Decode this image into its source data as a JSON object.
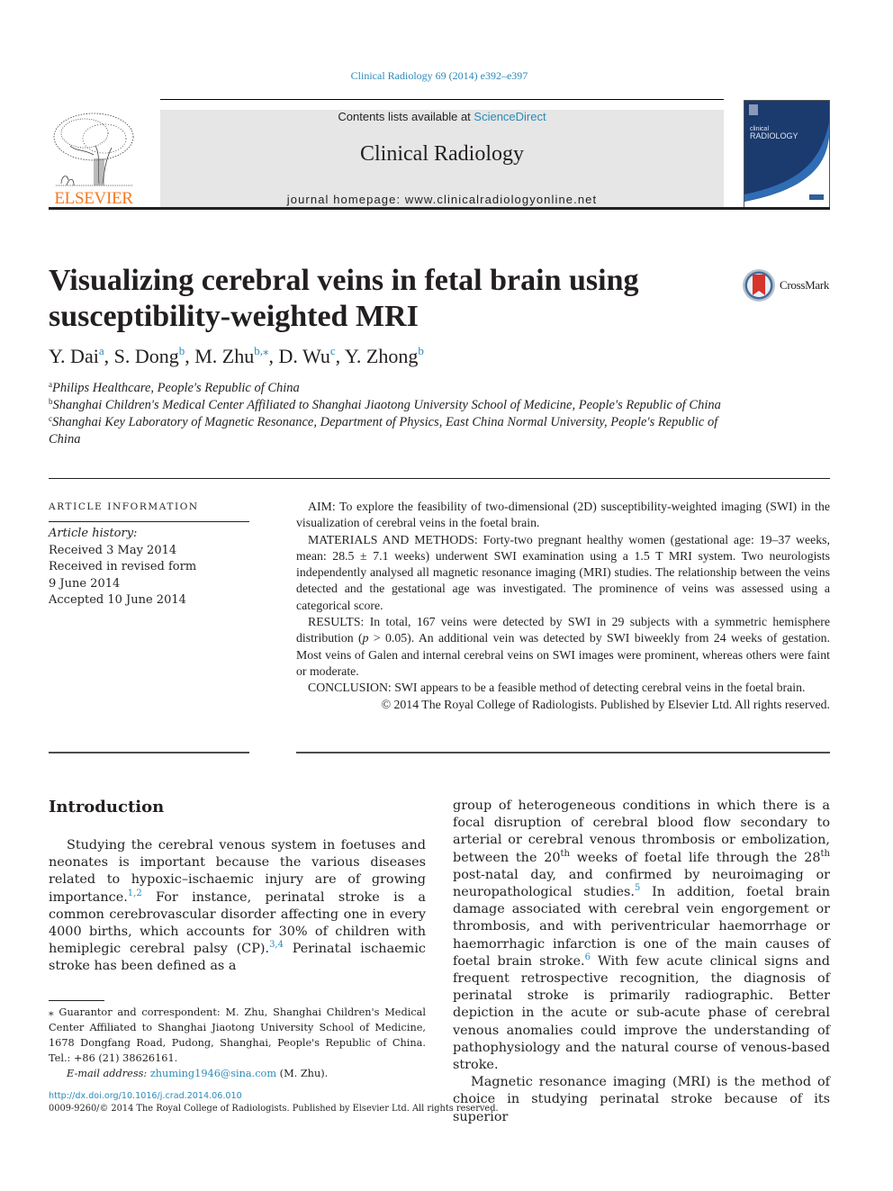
{
  "header": {
    "citation": "Clinical Radiology 69 (2014) e392–e397",
    "publisher_logo_text": "ELSEVIER",
    "contents_prefix": "Contents lists available at ",
    "contents_link": "ScienceDirect",
    "journal_name": "Clinical Radiology",
    "homepage_prefix": "journal homepage: ",
    "homepage_url": "www.clinicalradiologyonline.net",
    "cover_title_line1": "clinical",
    "cover_title_line2": "RADIOLOGY"
  },
  "article": {
    "title": "Visualizing cerebral veins in fetal brain using susceptibility-weighted MRI",
    "crossmark_label": "CrossMark",
    "authors": [
      {
        "name": "Y. Dai",
        "aff": "a"
      },
      {
        "name": "S. Dong",
        "aff": "b"
      },
      {
        "name": "M. Zhu",
        "aff": "b,⁎"
      },
      {
        "name": "D. Wu",
        "aff": "c"
      },
      {
        "name": "Y. Zhong",
        "aff": "b"
      }
    ],
    "affiliations": [
      {
        "key": "a",
        "text": "Philips Healthcare, People's Republic of China"
      },
      {
        "key": "b",
        "text": "Shanghai Children's Medical Center Affiliated to Shanghai Jiaotong University School of Medicine, People's Republic of China"
      },
      {
        "key": "c",
        "text": "Shanghai Key Laboratory of Magnetic Resonance, Department of Physics, East China Normal University, People's Republic of China"
      }
    ]
  },
  "article_info": {
    "heading": "ARTICLE INFORMATION",
    "history_label": "Article history:",
    "lines": [
      "Received 3 May 2014",
      "Received in revised form",
      "9 June 2014",
      "Accepted 10 June 2014"
    ]
  },
  "abstract": {
    "aim": "AIM: To explore the feasibility of two-dimensional (2D) susceptibility-weighted imaging (SWI) in the visualization of cerebral veins in the foetal brain.",
    "methods": "MATERIALS AND METHODS: Forty-two pregnant healthy women (gestational age: 19–37 weeks, mean: 28.5 ± 7.1 weeks) underwent SWI examination using a 1.5 T MRI system. Two neurologists independently analysed all magnetic resonance imaging (MRI) studies. The relationship between the veins detected and the gestational age was investigated. The prominence of veins was assessed using a categorical score.",
    "results_part1": "RESULTS: In total, 167 veins were detected by SWI in 29 subjects with a symmetric hemisphere distribution (",
    "results_p": "p",
    "results_part2": " > 0.05). An additional vein was detected by SWI biweekly from 24 weeks of gestation. Most veins of Galen and internal cerebral veins on SWI images were prominent, whereas others were faint or moderate.",
    "conclusion": "CONCLUSION: SWI appears to be a feasible method of detecting cerebral veins in the foetal brain.",
    "copyright": "© 2014 The Royal College of Radiologists. Published by Elsevier Ltd. All rights reserved."
  },
  "body": {
    "intro_heading": "Introduction",
    "left_p1_a": "Studying the cerebral venous system in foetuses and neonates is important because the various diseases related to hypoxic–ischaemic injury are of growing importance.",
    "left_p1_ref1": "1,2",
    "left_p1_b": " For instance, perinatal stroke is a common cerebrovascular disorder affecting one in every 4000 births, which accounts for 30% of children with hemiplegic cerebral palsy (CP).",
    "left_p1_ref2": "3,4",
    "left_p1_c": " Perinatal ischaemic stroke has been defined as a",
    "right_p1_a": "group of heterogeneous conditions in which there is a focal disruption of cerebral blood flow secondary to arterial or cerebral venous thrombosis or embolization, between the 20",
    "right_p1_th1": "th",
    "right_p1_b": " weeks of foetal life through the 28",
    "right_p1_th2": "th",
    "right_p1_c": " post-natal day, and confirmed by neuroimaging or neuropathological studies.",
    "right_p1_ref1": "5",
    "right_p1_d": " In addition, foetal brain damage associated with cerebral vein engorgement or thrombosis, and with periventricular haemorrhage or haemorrhagic infarction is one of the main causes of foetal brain stroke.",
    "right_p1_ref2": "6",
    "right_p1_e": " With few acute clinical signs and frequent retrospective recognition, the diagnosis of perinatal stroke is primarily radiographic. Better depiction in the acute or sub-acute phase of cerebral venous anomalies could improve the understanding of pathophysiology and the natural course of venous-based stroke.",
    "right_p2": "Magnetic resonance imaging (MRI) is the method of choice in studying perinatal stroke because of its superior"
  },
  "footnote": {
    "text": "⁎ Guarantor and correspondent: M. Zhu, Shanghai Children's Medical Center Affiliated to Shanghai Jiaotong University School of Medicine, 1678 Dongfang Road, Pudong, Shanghai, People's Republic of China. Tel.: +86 (21) 38626161.",
    "email_label": "E-mail address: ",
    "email": "zhuming1946@sina.com",
    "email_suffix": " (M. Zhu)."
  },
  "footer": {
    "doi": "http://dx.doi.org/10.1016/j.crad.2014.06.010",
    "issn_copyright": "0009-9260/© 2014 The Royal College of Radiologists. Published by Elsevier Ltd. All rights reserved."
  },
  "colors": {
    "link": "#2a8ab8",
    "elsevier_orange": "#f47920",
    "journal_box_bg": "#e6e6e6",
    "cover_blue": "#1b3a6e"
  }
}
